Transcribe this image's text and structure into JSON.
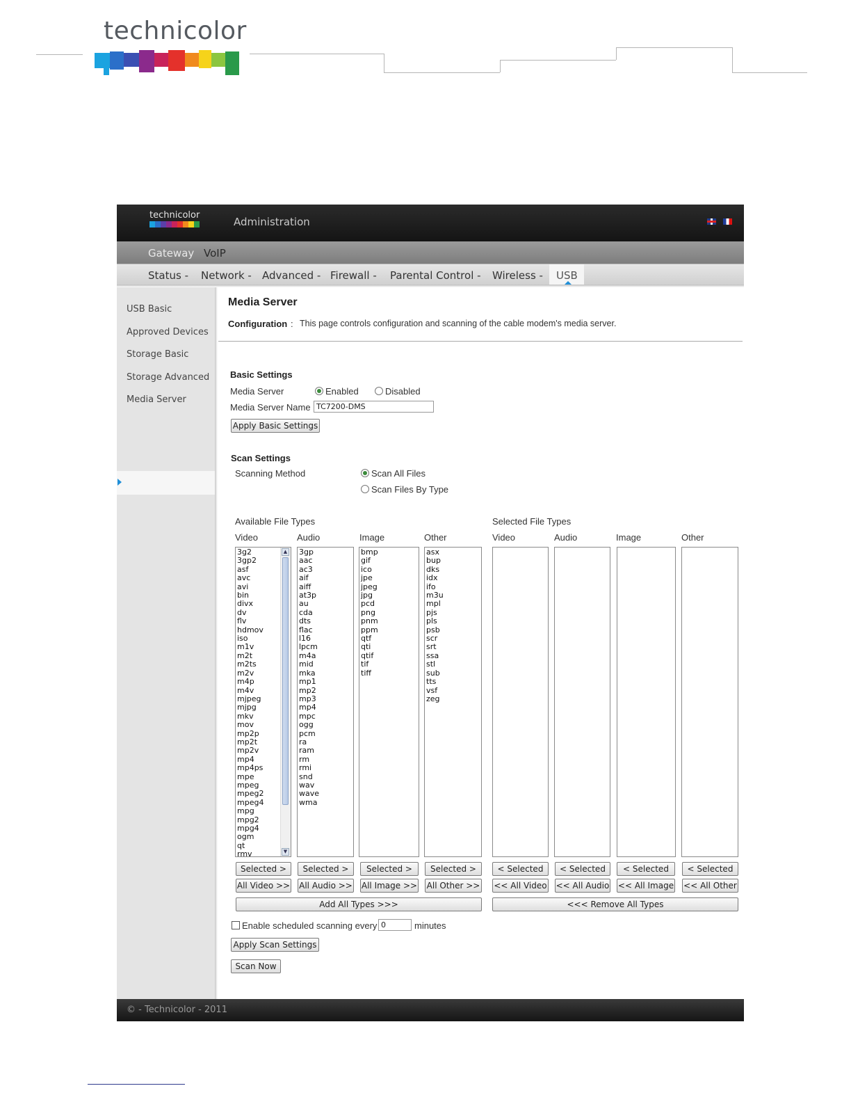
{
  "document": {
    "logo_text": "technicolor"
  },
  "app": {
    "logo_text": "technicolor",
    "title": "Administration",
    "flags": [
      "uk-flag",
      "fr-flag"
    ],
    "nav_primary": [
      "Gateway",
      "VoIP"
    ],
    "nav_secondary": [
      "Status -",
      "Network -",
      "Advanced -",
      "Firewall -",
      "Parental Control -",
      "Wireless -",
      "USB"
    ],
    "nav_secondary_active": "USB",
    "sidebar": [
      "USB Basic",
      "Approved Devices",
      "Storage Basic",
      "Storage Advanced",
      "Media Server"
    ],
    "sidebar_active": "Media Server",
    "footer": "© - Technicolor - 2011"
  },
  "page": {
    "title": "Media Server",
    "config_label": "Configuration",
    "config_sep": ":",
    "config_desc": "This page controls configuration and scanning of the cable modem's media server."
  },
  "basic": {
    "heading": "Basic Settings",
    "media_server_label": "Media Server",
    "enabled_label": "Enabled",
    "disabled_label": "Disabled",
    "enabled_checked": true,
    "name_label": "Media Server Name",
    "name_value": "TC7200-DMS",
    "apply_label": "Apply Basic Settings"
  },
  "scan": {
    "heading": "Scan Settings",
    "method_label": "Scanning Method",
    "all_files_label": "Scan All Files",
    "by_type_label": "Scan Files By Type",
    "all_files_checked": true,
    "available_label": "Available File Types",
    "selected_label": "Selected File Types",
    "columns": [
      "Video",
      "Audio",
      "Image",
      "Other"
    ],
    "available": {
      "video": [
        "3g2",
        "3gp2",
        "asf",
        "avc",
        "avi",
        "bin",
        "divx",
        "dv",
        "flv",
        "hdmov",
        "iso",
        "m1v",
        "m2t",
        "m2ts",
        "m2v",
        "m4p",
        "m4v",
        "mjpeg",
        "mjpg",
        "mkv",
        "mov",
        "mp2p",
        "mp2t",
        "mp2v",
        "mp4",
        "mp4ps",
        "mpe",
        "mpeg",
        "mpeg2",
        "mpeg4",
        "mpg",
        "mpg2",
        "mpg4",
        "ogm",
        "qt",
        "rmv"
      ],
      "audio": [
        "3gp",
        "aac",
        "ac3",
        "aif",
        "aiff",
        "at3p",
        "au",
        "cda",
        "dts",
        "flac",
        "l16",
        "lpcm",
        "m4a",
        "mid",
        "mka",
        "mp1",
        "mp2",
        "mp3",
        "mp4",
        "mpc",
        "ogg",
        "pcm",
        "ra",
        "ram",
        "rm",
        "rmi",
        "snd",
        "wav",
        "wave",
        "wma"
      ],
      "image": [
        "bmp",
        "gif",
        "ico",
        "jpe",
        "jpeg",
        "jpg",
        "pcd",
        "png",
        "pnm",
        "ppm",
        "qtf",
        "qti",
        "qtif",
        "tif",
        "tiff"
      ],
      "other": [
        "asx",
        "bup",
        "dks",
        "idx",
        "ifo",
        "m3u",
        "mpl",
        "pjs",
        "pls",
        "psb",
        "scr",
        "srt",
        "ssa",
        "stl",
        "sub",
        "tts",
        "vsf",
        "zeg"
      ]
    },
    "add_selected": "Selected >",
    "remove_selected": "< Selected",
    "add_all": [
      "All Video >>",
      "All Audio >>",
      "All Image >>",
      "All Other >>"
    ],
    "remove_all": [
      "<< All Video",
      "<< All Audio",
      "<< All Image",
      "<< All Other"
    ],
    "add_all_types": "Add All Types >>>",
    "remove_all_types": "<<< Remove All Types",
    "schedule_label": "Enable scheduled scanning every",
    "schedule_value": "0",
    "schedule_unit": "minutes",
    "schedule_checked": false,
    "apply_label": "Apply Scan Settings",
    "scan_now_label": "Scan Now"
  },
  "colors": {
    "accent": "#1f8fd8",
    "brand_bar": [
      "#1ba3e0",
      "#2b6fc9",
      "#5a3fa8",
      "#8b2a8c",
      "#c8235a",
      "#e4312b",
      "#f08a1d",
      "#f6d31a",
      "#8cc63f",
      "#2a9a4a"
    ]
  }
}
